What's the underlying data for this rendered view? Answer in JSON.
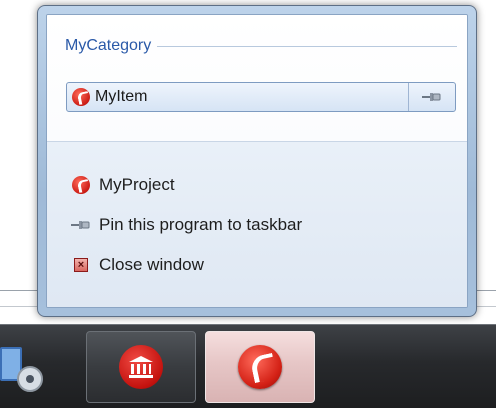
{
  "jumplist": {
    "category_title": "MyCategory",
    "item": {
      "label": "MyItem",
      "icon": "app-icon",
      "pin_icon": "pin-icon"
    },
    "tasks": [
      {
        "label": "MyProject",
        "icon": "app-icon"
      },
      {
        "label": "Pin this program to taskbar",
        "icon": "pin-icon"
      },
      {
        "label": "Close window",
        "icon": "close-icon"
      }
    ]
  },
  "taskbar": {
    "buttons": [
      {
        "icon": "bank-icon"
      },
      {
        "icon": "app-icon",
        "active": true
      }
    ]
  },
  "colors": {
    "category_text": "#2a59a8",
    "app_red": "#d32015",
    "taskbar": "#27292c"
  }
}
